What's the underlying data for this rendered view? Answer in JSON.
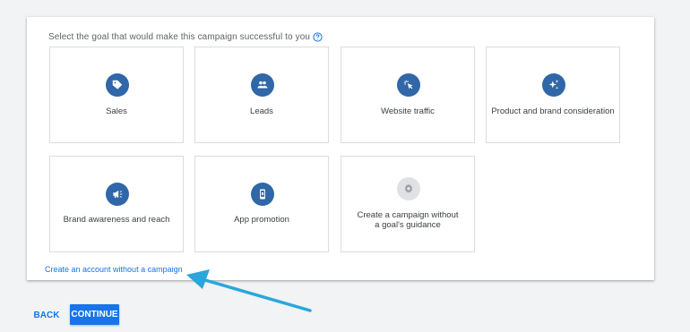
{
  "prompt": {
    "text": "Select the goal that would make this campaign successful to you",
    "help_icon": "help-circle-icon"
  },
  "goals": [
    {
      "label": "Sales",
      "icon": "tag-icon"
    },
    {
      "label": "Leads",
      "icon": "people-icon"
    },
    {
      "label": "Website traffic",
      "icon": "cursor-click-icon"
    },
    {
      "label": "Product and brand consideration",
      "icon": "sparkle-icon"
    },
    {
      "label": "Brand awareness and reach",
      "icon": "megaphone-icon"
    },
    {
      "label": "App promotion",
      "icon": "smartphone-icon"
    },
    {
      "label": "Create a campaign without a goal's guidance",
      "icon": "gear-icon"
    }
  ],
  "links": {
    "no_campaign": "Create an account without a campaign"
  },
  "footer": {
    "back_label": "BACK",
    "continue_label": "CONTINUE"
  },
  "colors": {
    "accent": "#1a73e8",
    "icon_circle": "#2f67a8",
    "arrow": "#2aa6dc"
  }
}
